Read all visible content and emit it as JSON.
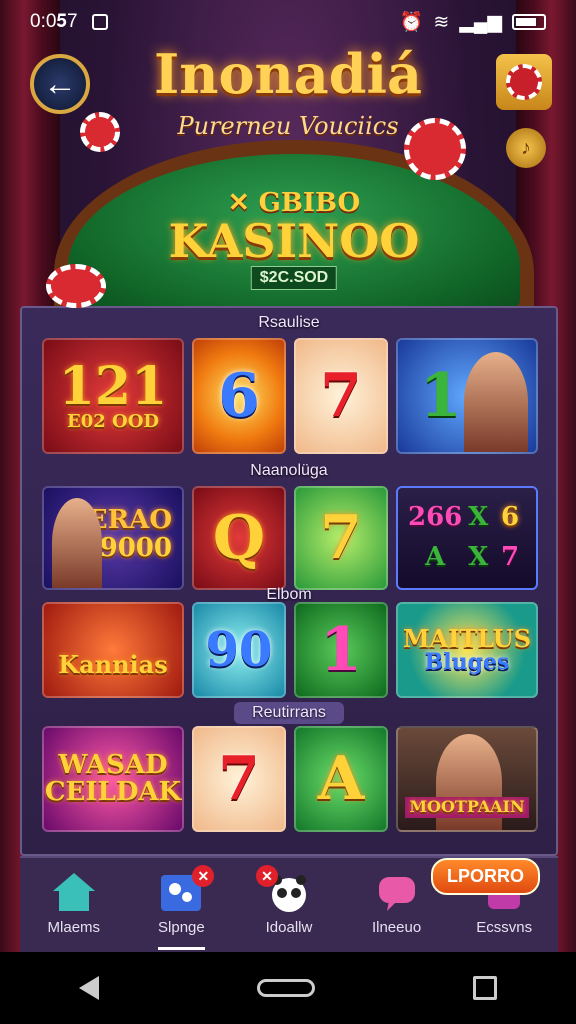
{
  "status": {
    "time": "0:0𝟓7",
    "signal": "📶"
  },
  "header": {
    "title": "Inonadiá",
    "subtitle": "Purerneu Vouciics",
    "table_top": "✕ GBIBO",
    "table_name": "KASINOO",
    "table_amount": "$2C.SOD"
  },
  "sections": {
    "s1": "Rsaulise",
    "s2": "Naanolüga",
    "s3": "Elbom",
    "s4": "Reutirrans"
  },
  "tiles": {
    "r1": [
      "121",
      "6",
      "7",
      "1"
    ],
    "r1_sub": "E02 OOD",
    "r2_text": [
      "ERAO",
      "9000"
    ],
    "r2": [
      "Q",
      "7"
    ],
    "r2_slot": [
      "266",
      "X",
      "6",
      "A",
      "X",
      "7"
    ],
    "r3": [
      "Kannias",
      "90",
      "1",
      "MAITLUS",
      "Bluges"
    ],
    "r4": [
      "WASAD",
      "CEILDAK",
      "7",
      "A",
      "MOOTPAAIN"
    ]
  },
  "nav": {
    "items": [
      {
        "label": "Mlaems"
      },
      {
        "label": "Slpnge",
        "badge": "✕"
      },
      {
        "label": "Idoallw",
        "badge": "✕"
      },
      {
        "label": "Ilneeuo"
      },
      {
        "label": "Ecssvns"
      }
    ],
    "promo": "LPORRO"
  },
  "colors": {
    "accent": "#ffd23a",
    "panel": "#3a2a5a",
    "badge": "#e0202a"
  }
}
